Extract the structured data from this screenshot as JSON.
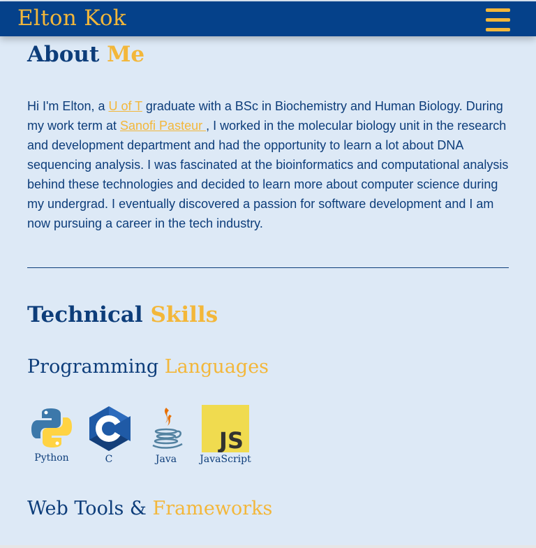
{
  "header": {
    "brand": "Elton Kok",
    "menu_icon": "hamburger-menu-icon"
  },
  "about": {
    "title_part1": "About",
    "title_part2": "Me",
    "text_1": "Hi I'm Elton, a ",
    "link_1": "U of T",
    "text_2": " graduate with a BSc in Biochemistry and Human Biology. During my work term at ",
    "link_2": "Sanofi Pasteur ",
    "text_3": ", I worked in the molecular biology unit in the research and development department and had the opportunity to learn a lot about DNA sequencing analysis. I was fascinated at the bioinformatics and computational analysis behind these technologies and decided to learn more about computer science during my undergrad. I eventually discovered a passion for software development and I am now pursuing a career in the tech industry."
  },
  "skills": {
    "title_part1": "Technical",
    "title_part2": "Skills",
    "programming": {
      "part1": "Programming",
      "part2": "Languages"
    },
    "languages": [
      {
        "label": "Python",
        "icon": "python-icon"
      },
      {
        "label": "C",
        "icon": "c-icon"
      },
      {
        "label": "Java",
        "icon": "java-icon"
      },
      {
        "label": "JavaScript",
        "icon": "javascript-icon"
      }
    ],
    "web": {
      "part1": "Web Tools &",
      "part2": "Frameworks"
    }
  },
  "colors": {
    "accent": "#f3b73a",
    "primary": "#0d3d7a",
    "header_bg": "#05418a",
    "page_bg": "#dde9f6"
  }
}
